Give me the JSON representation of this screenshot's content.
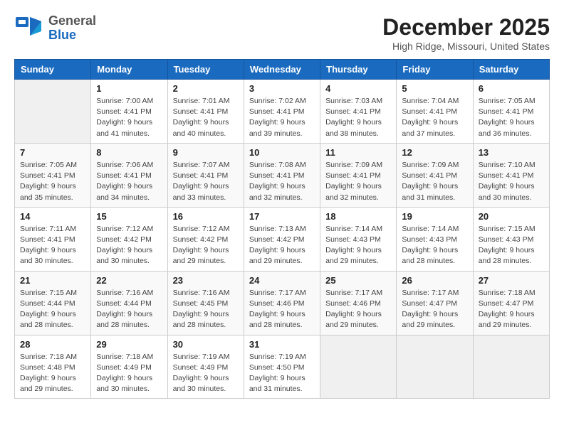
{
  "header": {
    "logo_general": "General",
    "logo_blue": "Blue",
    "month_year": "December 2025",
    "location": "High Ridge, Missouri, United States"
  },
  "weekdays": [
    "Sunday",
    "Monday",
    "Tuesday",
    "Wednesday",
    "Thursday",
    "Friday",
    "Saturday"
  ],
  "weeks": [
    [
      {
        "day": "",
        "empty": true
      },
      {
        "day": "1",
        "sunrise": "7:00 AM",
        "sunset": "4:41 PM",
        "daylight": "9 hours and 41 minutes."
      },
      {
        "day": "2",
        "sunrise": "7:01 AM",
        "sunset": "4:41 PM",
        "daylight": "9 hours and 40 minutes."
      },
      {
        "day": "3",
        "sunrise": "7:02 AM",
        "sunset": "4:41 PM",
        "daylight": "9 hours and 39 minutes."
      },
      {
        "day": "4",
        "sunrise": "7:03 AM",
        "sunset": "4:41 PM",
        "daylight": "9 hours and 38 minutes."
      },
      {
        "day": "5",
        "sunrise": "7:04 AM",
        "sunset": "4:41 PM",
        "daylight": "9 hours and 37 minutes."
      },
      {
        "day": "6",
        "sunrise": "7:05 AM",
        "sunset": "4:41 PM",
        "daylight": "9 hours and 36 minutes."
      }
    ],
    [
      {
        "day": "7",
        "sunrise": "7:05 AM",
        "sunset": "4:41 PM",
        "daylight": "9 hours and 35 minutes."
      },
      {
        "day": "8",
        "sunrise": "7:06 AM",
        "sunset": "4:41 PM",
        "daylight": "9 hours and 34 minutes."
      },
      {
        "day": "9",
        "sunrise": "7:07 AM",
        "sunset": "4:41 PM",
        "daylight": "9 hours and 33 minutes."
      },
      {
        "day": "10",
        "sunrise": "7:08 AM",
        "sunset": "4:41 PM",
        "daylight": "9 hours and 32 minutes."
      },
      {
        "day": "11",
        "sunrise": "7:09 AM",
        "sunset": "4:41 PM",
        "daylight": "9 hours and 32 minutes."
      },
      {
        "day": "12",
        "sunrise": "7:09 AM",
        "sunset": "4:41 PM",
        "daylight": "9 hours and 31 minutes."
      },
      {
        "day": "13",
        "sunrise": "7:10 AM",
        "sunset": "4:41 PM",
        "daylight": "9 hours and 30 minutes."
      }
    ],
    [
      {
        "day": "14",
        "sunrise": "7:11 AM",
        "sunset": "4:41 PM",
        "daylight": "9 hours and 30 minutes."
      },
      {
        "day": "15",
        "sunrise": "7:12 AM",
        "sunset": "4:42 PM",
        "daylight": "9 hours and 30 minutes."
      },
      {
        "day": "16",
        "sunrise": "7:12 AM",
        "sunset": "4:42 PM",
        "daylight": "9 hours and 29 minutes."
      },
      {
        "day": "17",
        "sunrise": "7:13 AM",
        "sunset": "4:42 PM",
        "daylight": "9 hours and 29 minutes."
      },
      {
        "day": "18",
        "sunrise": "7:14 AM",
        "sunset": "4:43 PM",
        "daylight": "9 hours and 29 minutes."
      },
      {
        "day": "19",
        "sunrise": "7:14 AM",
        "sunset": "4:43 PM",
        "daylight": "9 hours and 28 minutes."
      },
      {
        "day": "20",
        "sunrise": "7:15 AM",
        "sunset": "4:43 PM",
        "daylight": "9 hours and 28 minutes."
      }
    ],
    [
      {
        "day": "21",
        "sunrise": "7:15 AM",
        "sunset": "4:44 PM",
        "daylight": "9 hours and 28 minutes."
      },
      {
        "day": "22",
        "sunrise": "7:16 AM",
        "sunset": "4:44 PM",
        "daylight": "9 hours and 28 minutes."
      },
      {
        "day": "23",
        "sunrise": "7:16 AM",
        "sunset": "4:45 PM",
        "daylight": "9 hours and 28 minutes."
      },
      {
        "day": "24",
        "sunrise": "7:17 AM",
        "sunset": "4:46 PM",
        "daylight": "9 hours and 28 minutes."
      },
      {
        "day": "25",
        "sunrise": "7:17 AM",
        "sunset": "4:46 PM",
        "daylight": "9 hours and 29 minutes."
      },
      {
        "day": "26",
        "sunrise": "7:17 AM",
        "sunset": "4:47 PM",
        "daylight": "9 hours and 29 minutes."
      },
      {
        "day": "27",
        "sunrise": "7:18 AM",
        "sunset": "4:47 PM",
        "daylight": "9 hours and 29 minutes."
      }
    ],
    [
      {
        "day": "28",
        "sunrise": "7:18 AM",
        "sunset": "4:48 PM",
        "daylight": "9 hours and 29 minutes."
      },
      {
        "day": "29",
        "sunrise": "7:18 AM",
        "sunset": "4:49 PM",
        "daylight": "9 hours and 30 minutes."
      },
      {
        "day": "30",
        "sunrise": "7:19 AM",
        "sunset": "4:49 PM",
        "daylight": "9 hours and 30 minutes."
      },
      {
        "day": "31",
        "sunrise": "7:19 AM",
        "sunset": "4:50 PM",
        "daylight": "9 hours and 31 minutes."
      },
      {
        "day": "",
        "empty": true
      },
      {
        "day": "",
        "empty": true
      },
      {
        "day": "",
        "empty": true
      }
    ]
  ],
  "labels": {
    "sunrise": "Sunrise:",
    "sunset": "Sunset:",
    "daylight": "Daylight:"
  }
}
